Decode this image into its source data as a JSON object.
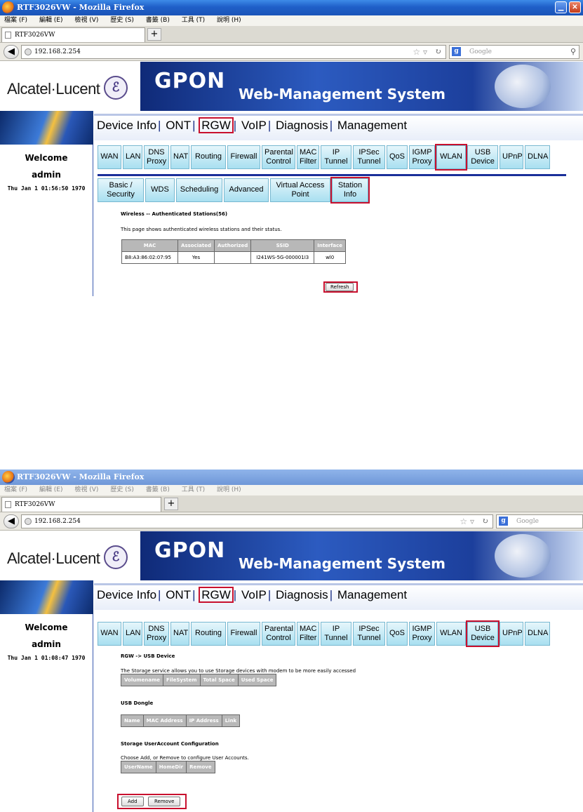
{
  "browser": {
    "window_title": "RTF3026VW - Mozilla Firefox",
    "menu": [
      "檔案 (F)",
      "編輯 (E)",
      "檢視 (V)",
      "歷史 (S)",
      "書籤 (B)",
      "工具 (T)",
      "說明 (H)"
    ],
    "tab_title": "RTF3026VW",
    "url": "192.168.2.254",
    "search_placeholder": "Google"
  },
  "banner": {
    "brand": "Alcatel·Lucent",
    "title": "GPON",
    "subtitle": "Web-Management System"
  },
  "sidebar": {
    "welcome": "Welcome",
    "user": "admin"
  },
  "main_nav": [
    "Device Info",
    "ONT",
    "RGW",
    "VoIP",
    "Diagnosis",
    "Management"
  ],
  "rgw_tabs": [
    "WAN",
    "LAN",
    "DNS\nProxy",
    "NAT",
    "Routing",
    "Firewall",
    "Parental\nControl",
    "MAC\nFilter",
    "IP\nTunnel",
    "IPSec\nTunnel",
    "QoS",
    "IGMP\nProxy",
    "WLAN",
    "USB\nDevice",
    "UPnP",
    "DLNA"
  ],
  "screen1": {
    "clock": "Thu Jan 1 01:56:50 1970",
    "wlan_tabs": [
      "Basic /\nSecurity",
      "WDS",
      "Scheduling",
      "Advanced",
      "Virtual Access\nPoint",
      "Station\nInfo"
    ],
    "heading": "Wireless -- Authenticated Stations(56)",
    "description": "This page shows authenticated wireless stations and their status.",
    "table_headers": [
      "MAC",
      "Associated",
      "Authorized",
      "SSID",
      "Interface"
    ],
    "table_rows": [
      [
        "B8:A3:86:02:07:95",
        "Yes",
        "",
        "I241WS-5G-000001I3",
        "wl0"
      ]
    ],
    "refresh_label": "Refresh"
  },
  "screen2": {
    "clock": "Thu Jan 1 01:08:47 1970",
    "heading": "RGW -> USB Device",
    "storage_desc": "The Storage service allows you to use Storage devices with modem to be more easily accessed",
    "storage_headers": [
      "Volumename",
      "FileSystem",
      "Total Space",
      "Used Space"
    ],
    "dongle_title": "USB Dongle",
    "dongle_headers": [
      "Name",
      "MAC Address",
      "IP Address",
      "Link"
    ],
    "account_title": "Storage UserAccount Configuration",
    "account_desc": "Choose Add, or Remove to configure User Accounts.",
    "account_headers": [
      "UserName",
      "HomeDir",
      "Remove"
    ],
    "add_label": "Add",
    "remove_label": "Remove"
  },
  "colors": {
    "highlight_box": "#c8102e",
    "nav_separator": "#1a2f86",
    "subtab_fill": "#a8dff0",
    "header_fill": "#0f2a78"
  }
}
